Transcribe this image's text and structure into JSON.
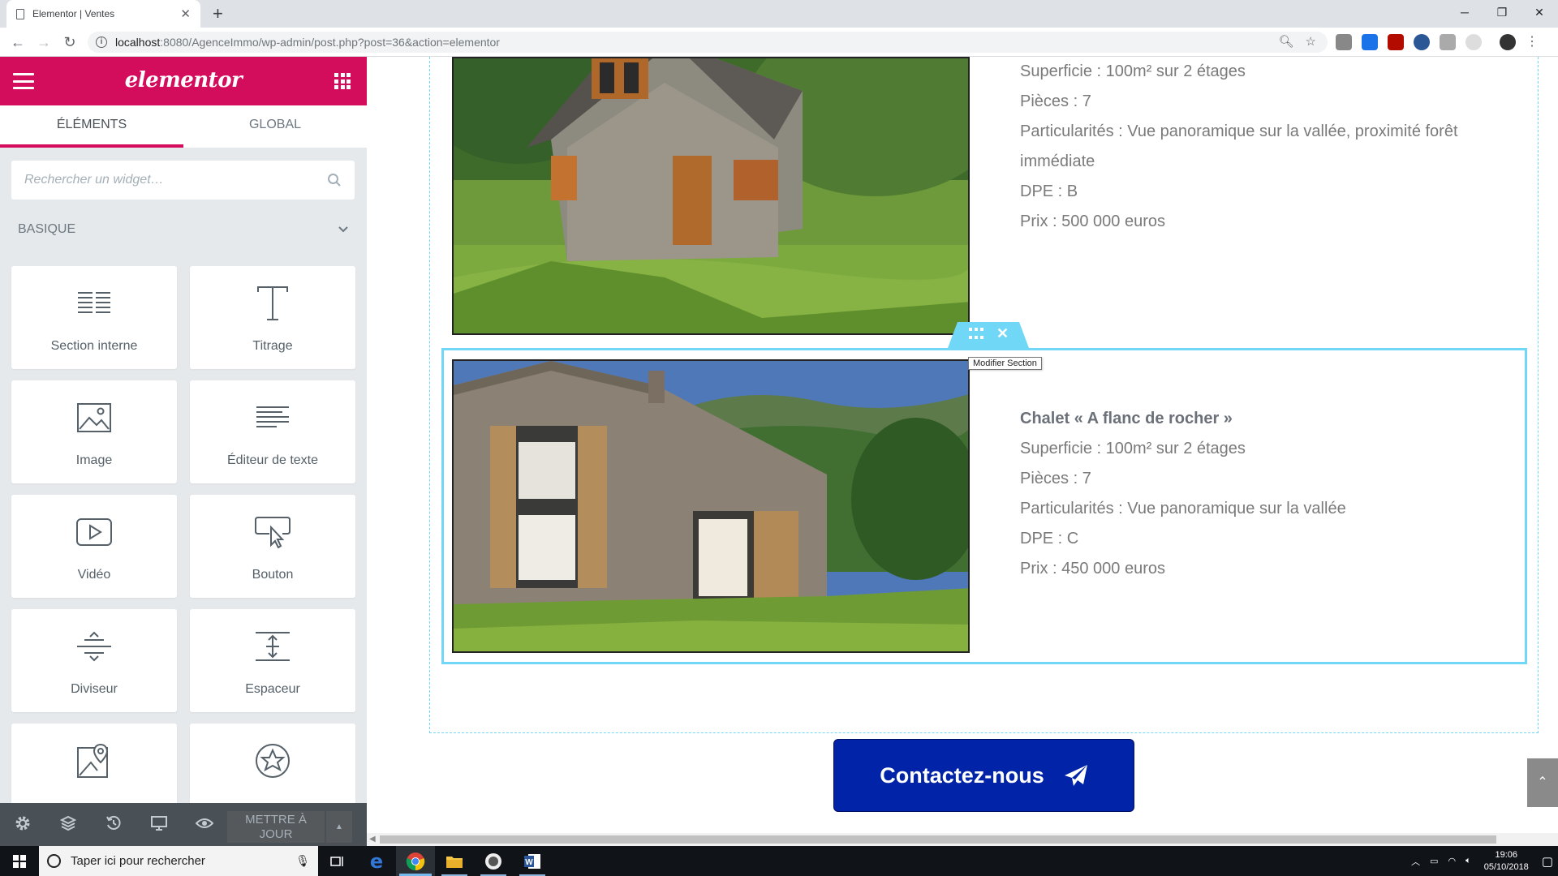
{
  "browser": {
    "tab_title": "Elementor | Ventes",
    "url_host": "localhost",
    "url_path": ":8080/AgenceImmo/wp-admin/post.php?post=36&action=elementor"
  },
  "panel": {
    "logo": "elementor",
    "tabs": [
      "ÉLÉMENTS",
      "GLOBAL"
    ],
    "search_placeholder": "Rechercher un widget…",
    "category": "BASIQUE",
    "widgets": [
      {
        "label": "Section interne",
        "icon": "columns-icon"
      },
      {
        "label": "Titrage",
        "icon": "heading-icon"
      },
      {
        "label": "Image",
        "icon": "image-icon"
      },
      {
        "label": "Éditeur de texte",
        "icon": "text-editor-icon"
      },
      {
        "label": "Vidéo",
        "icon": "video-icon"
      },
      {
        "label": "Bouton",
        "icon": "button-icon"
      },
      {
        "label": "Diviseur",
        "icon": "divider-icon"
      },
      {
        "label": "Espaceur",
        "icon": "spacer-icon"
      },
      {
        "label": "",
        "icon": "google-maps-icon"
      },
      {
        "label": "",
        "icon": "star-icon"
      }
    ],
    "publish_label": "METTRE À JOUR"
  },
  "preview": {
    "listing1": {
      "lines": [
        "Superficie : 100m² sur 2 étages",
        "Pièces : 7",
        "Particularités : Vue panoramique sur la vallée, proximité forêt immédiate",
        "DPE : B",
        "Prix : 500 000 euros"
      ]
    },
    "listing2": {
      "title": "Chalet « A flanc de rocher »",
      "lines": [
        "Superficie : 100m² sur 2 étages",
        "Pièces : 7",
        "Particularités : Vue panoramique sur la vallée",
        "DPE : C",
        "Prix : 450 000 euros"
      ]
    },
    "tooltip": "Modifier Section",
    "cta_label": "Contactez-nous"
  },
  "taskbar": {
    "search_placeholder": "Taper ici pour rechercher",
    "time": "19:06",
    "date": "05/10/2018"
  },
  "colors": {
    "elementor_pink": "#d30c5c",
    "section_blue": "#71d7f7",
    "cta_blue": "#0023a7"
  }
}
